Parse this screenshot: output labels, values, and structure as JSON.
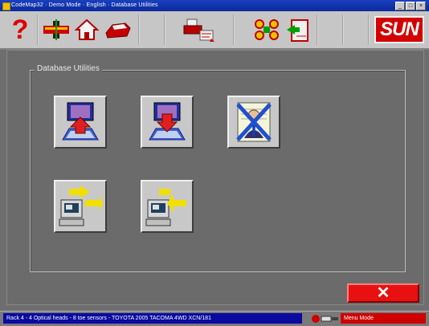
{
  "window": {
    "title": "CodeMap32 · Demo Mode · English · Database Utilities",
    "controls": [
      "_",
      "□",
      "×"
    ]
  },
  "toolbar": {
    "help_label": "?",
    "brand_label": "SUN",
    "icons": [
      "help-icon",
      "vehicle-spec-icon",
      "home-icon",
      "vehicle-icon",
      "print-icon",
      "sensor-heads-icon",
      "clipboard-icon"
    ]
  },
  "main": {
    "group_title": "Database Utilities",
    "tiles": [
      {
        "name": "database-export-icon"
      },
      {
        "name": "database-import-icon"
      },
      {
        "name": "delete-customer-icon"
      },
      {
        "name": "transfer-out-icon"
      },
      {
        "name": "transfer-in-icon"
      }
    ]
  },
  "close_button": {
    "label": "✕"
  },
  "status": {
    "text": "Rack 4 - 4 Optical heads - 8 toe sensors - TOYOTA 2005 TACOMA 4WD XCN/181",
    "mode": "Menu Mode"
  },
  "colors": {
    "accent_red": "#e81010",
    "status_blue": "#0a0aa0",
    "background": "#6b6b6b"
  }
}
